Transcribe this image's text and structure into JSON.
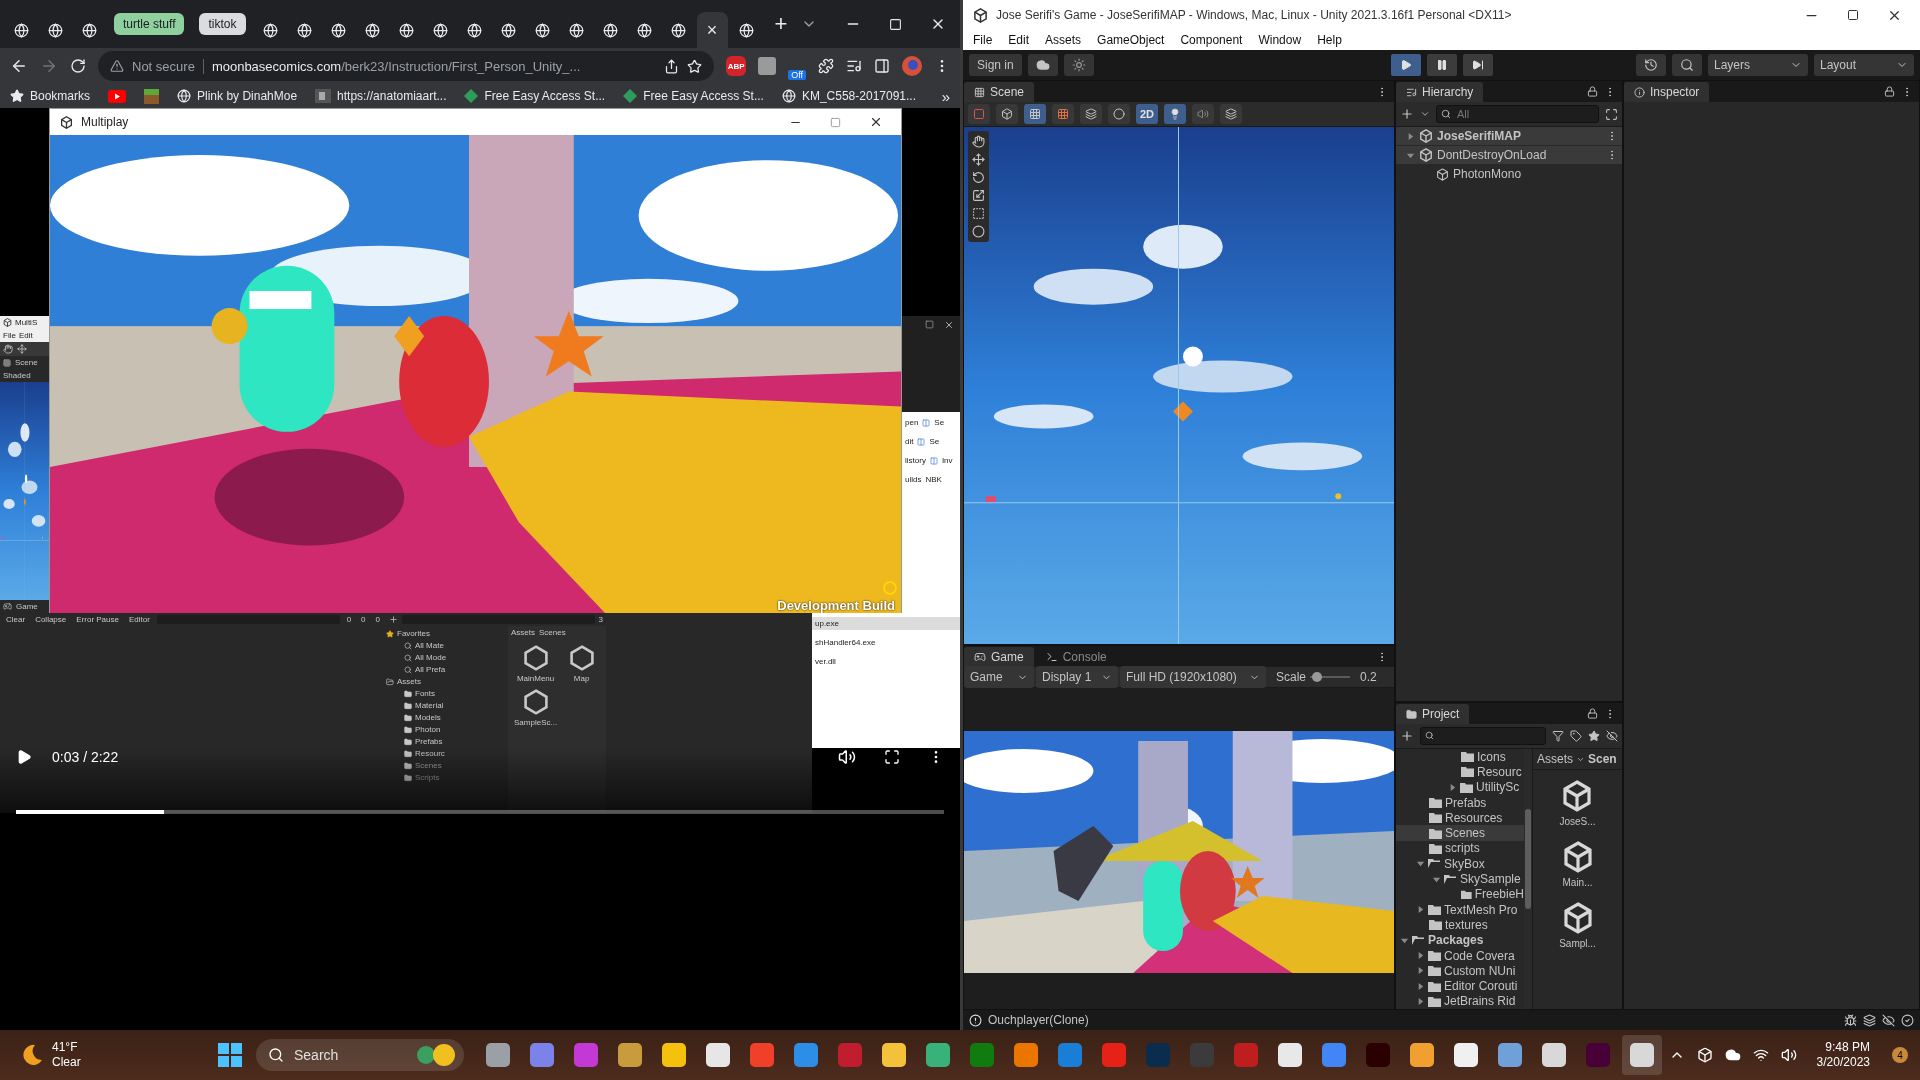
{
  "browser": {
    "tabs": [
      {
        "kind": "page",
        "selected": false
      },
      {
        "kind": "page",
        "selected": false
      },
      {
        "kind": "page",
        "selected": false
      },
      {
        "kind": "group",
        "label": "turtle stuff",
        "color": "#8fd19e"
      },
      {
        "kind": "group",
        "label": "tiktok",
        "color": "#dadce0"
      },
      {
        "kind": "page",
        "selected": false
      },
      {
        "kind": "page",
        "selected": false
      },
      {
        "kind": "page",
        "selected": false
      },
      {
        "kind": "page",
        "selected": false
      },
      {
        "kind": "page",
        "selected": false
      },
      {
        "kind": "page",
        "selected": false
      },
      {
        "kind": "page",
        "selected": false
      },
      {
        "kind": "page",
        "selected": false
      },
      {
        "kind": "page",
        "selected": false
      },
      {
        "kind": "page",
        "selected": false
      },
      {
        "kind": "page",
        "selected": false
      },
      {
        "kind": "page",
        "selected": false
      },
      {
        "kind": "page",
        "selected": false
      },
      {
        "kind": "page",
        "selected": true,
        "close": "×"
      },
      {
        "kind": "page",
        "selected": false
      }
    ],
    "new_tab": "+",
    "address": {
      "security": "Not secure",
      "domain": "moonbasecomics.com",
      "path": "/berk23/Instruction/First_Person_Unity_..."
    },
    "adblock_label": "ABP",
    "extension_status": "Off",
    "bookmarks": [
      "Bookmarks",
      "Plink by DinahMoe",
      "https://anatomiaart...",
      "Free Easy Access St...",
      "Free Easy Access St...",
      "KM_C558-2017091..."
    ],
    "more": "»"
  },
  "video": {
    "game_window": {
      "title": "Multiplay",
      "overlay": "Development Build"
    },
    "background_editor": {
      "title": "MultiS",
      "menu": [
        "File",
        "Edit"
      ],
      "scene_tab": "Scene",
      "shading": "Shaded",
      "game_tab": "Game"
    },
    "console": {
      "buttons": [
        "Clear",
        "Collapse",
        "Error Pause",
        "Editor"
      ],
      "counts": [
        "0",
        "0",
        "0"
      ]
    },
    "project": {
      "count": "3",
      "favorites": "Favorites",
      "favorite_items": [
        "All Mate",
        "All Mode",
        "All Prefa"
      ],
      "assets": "Assets",
      "asset_items": [
        "Fonts",
        "Material",
        "Models",
        "Photon",
        "Prefabs",
        "Resourc",
        "Scenes",
        "Scripts"
      ],
      "breadcrumb": [
        "Assets",
        "Scenes"
      ],
      "files": [
        "MainMenu",
        "Map",
        "SampleSc..."
      ]
    },
    "explorer": {
      "ribbon": [
        "pen",
        "dit",
        "listory"
      ],
      "ribbon_right": [
        "Se",
        "Se",
        "Inv"
      ],
      "path": [
        "uilds",
        "NBK"
      ],
      "files": [
        "up.exe",
        "shHandler64.exe",
        "ver.dll"
      ]
    },
    "player": {
      "time": "0:03 / 2:22",
      "level": 0.16
    }
  },
  "unity": {
    "title": "Jose Serifi's Game - JoseSerifiMAP - Windows, Mac, Linux - Unity 2021.3.16f1 Personal <DX11>",
    "menu": [
      "File",
      "Edit",
      "Assets",
      "GameObject",
      "Component",
      "Window",
      "Help"
    ],
    "sign_in": "Sign in",
    "play_controls": [
      {
        "kind": "play",
        "selected": true
      },
      {
        "kind": "pause",
        "selected": false
      },
      {
        "kind": "step",
        "selected": false
      }
    ],
    "layers": "Layers",
    "layout": "Layout",
    "scene": {
      "tab": "Scene",
      "toggle_2d": {
        "label": "2D",
        "selected": true
      }
    },
    "hierarchy": {
      "tab": "Hierarchy",
      "search_placeholder": "All",
      "items": [
        {
          "label": "JoseSerifiMAP",
          "active": true,
          "expanded": false
        },
        {
          "label": "DontDestroyOnLoad",
          "active": false,
          "expanded": true,
          "children": [
            {
              "label": "PhotonMono"
            }
          ]
        }
      ]
    },
    "inspector": {
      "tab": "Inspector"
    },
    "game": {
      "tabs": [
        {
          "label": "Game",
          "selected": true
        },
        {
          "label": "Console",
          "selected": false
        }
      ],
      "view": "Game",
      "display": "Display 1",
      "resolution": "Full HD (1920x1080)",
      "scale": {
        "label": "Scale",
        "value": "0.2",
        "level": 0.05
      }
    },
    "project": {
      "tab": "Project",
      "tree": [
        {
          "children": [
            {
              "children": [
                {
                  "children": [
                    {
                      "label": "Icons",
                      "selected": false
                    },
                    {
                      "label": "Resourc",
                      "selected": false
                    },
                    {
                      "label": "UtilitySc",
                      "selected": false,
                      "expanded": false
                    }
                  ]
                }
              ]
            },
            {
              "label": "Prefabs",
              "selected": false
            },
            {
              "label": "Resources",
              "selected": false
            },
            {
              "label": "Scenes",
              "selected": true
            },
            {
              "label": "scripts",
              "selected": false
            },
            {
              "label": "SkyBox",
              "selected": false,
              "expanded": true,
              "children": [
                {
                  "label": "SkySample",
                  "selected": false,
                  "expanded": true,
                  "children": [
                    {
                      "label": "FreebieH",
                      "selected": false
                    }
                  ]
                }
              ]
            },
            {
              "label": "TextMesh Pro",
              "selected": false,
              "expanded": false
            },
            {
              "label": "textures",
              "selected": false
            }
          ]
        },
        {
          "label": "Packages",
          "selected": false,
          "expanded": true,
          "children": [
            {
              "label": "Code Covera",
              "selected": false,
              "expanded": false
            },
            {
              "label": "Custom NUni",
              "selected": false,
              "expanded": false
            },
            {
              "label": "Editor Corouti",
              "selected": false,
              "expanded": false
            },
            {
              "label": "JetBrains Rid",
              "selected": false,
              "expanded": false
            }
          ]
        }
      ],
      "breadcrumb": [
        "Assets",
        "Scen"
      ],
      "files": [
        "JoseS...",
        "Main...",
        "Sampl..."
      ]
    },
    "status": "Ouchplayer(Clone)"
  },
  "taskbar": {
    "weather": {
      "temp": "41°F",
      "condition": "Clear"
    },
    "search_placeholder": "Search",
    "apps": [
      {
        "color": "#9aa0a6",
        "selected": false
      },
      {
        "color": "#7b83eb",
        "selected": false
      },
      {
        "color": "#c239d6",
        "selected": false
      },
      {
        "color": "#c89b3c",
        "selected": false
      },
      {
        "color": "#f4c20d",
        "selected": false
      },
      {
        "color": "#e6e6e6",
        "selected": false
      },
      {
        "color": "#f0402a",
        "selected": false
      },
      {
        "color": "#2d8ee8",
        "selected": false
      },
      {
        "color": "#c01e2e",
        "selected": false
      },
      {
        "color": "#f3c13a",
        "selected": false
      },
      {
        "color": "#38b27a",
        "selected": false
      },
      {
        "color": "#107c10",
        "selected": false
      },
      {
        "color": "#ea7600",
        "selected": false
      },
      {
        "color": "#1b7ed6",
        "selected": false
      },
      {
        "color": "#e62117",
        "selected": false
      },
      {
        "color": "#0b2d4d",
        "selected": false
      },
      {
        "color": "#3b3b3b",
        "selected": false
      },
      {
        "color": "#bf1e1e",
        "selected": false
      },
      {
        "color": "#e8e8e8",
        "selected": false
      },
      {
        "color": "#4285f4",
        "selected": false
      },
      {
        "color": "#2b0000",
        "selected": false
      },
      {
        "color": "#f0a030",
        "selected": false
      },
      {
        "color": "#f0f0f0",
        "selected": false
      },
      {
        "color": "#6fa0d8",
        "selected": false
      },
      {
        "color": "#d8d8d8",
        "selected": false
      },
      {
        "color": "#470137",
        "selected": false
      },
      {
        "color": "#d8d8d8",
        "selected": true
      }
    ],
    "time": "9:48 PM",
    "date": "3/20/2023",
    "notifications": "4"
  }
}
